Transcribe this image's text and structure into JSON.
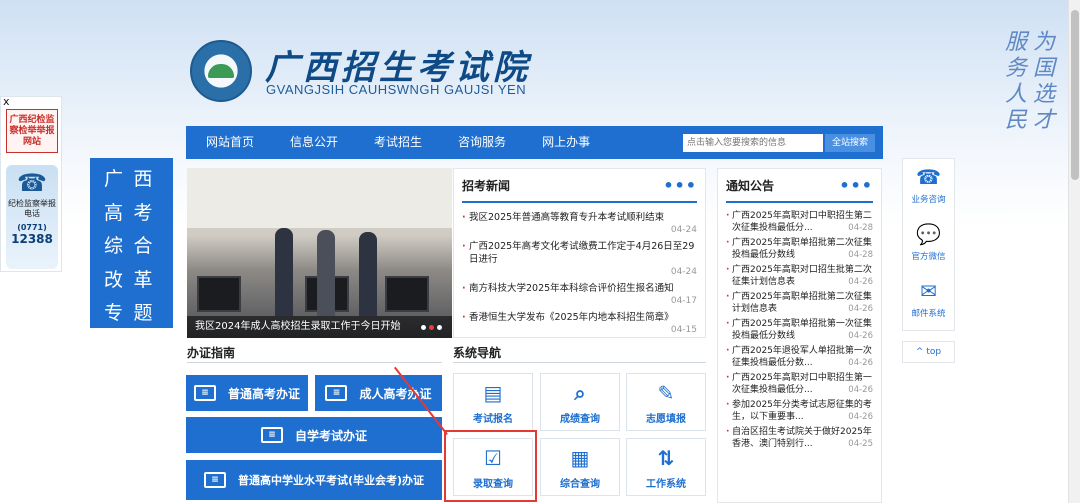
{
  "header": {
    "title": "广西招生考试院",
    "subtitle": "GVANGJSIH CAUHSWNGH GAUJSI YEN",
    "slogan": [
      "为",
      "服",
      "国",
      "务",
      "选",
      "人",
      "才",
      "民"
    ]
  },
  "left_float": {
    "close": "x",
    "jw_label": "广西纪检监察检举举报网站",
    "phone_label": "纪检监察举报电话",
    "phone_code": "(0771)",
    "phone_number": "12388"
  },
  "nav": {
    "items": [
      "网站首页",
      "信息公开",
      "考试招生",
      "咨询服务",
      "网上办事"
    ],
    "search_placeholder": "点击输入您要搜索的信息",
    "search_button": "全站搜索"
  },
  "special": [
    "广",
    "西",
    "高",
    "考",
    "综",
    "合",
    "改",
    "革",
    "专",
    "题"
  ],
  "photo": {
    "caption": "我区2024年成人高校招生录取工作于今日开始"
  },
  "news": {
    "title": "招考新闻",
    "more": "•••",
    "items": [
      {
        "text": "我区2025年普通高等教育专升本考试顺利结束",
        "date": "04-24"
      },
      {
        "text": "广西2025年高考文化考试缴费工作定于4月26日至29日进行",
        "date": "04-24"
      },
      {
        "text": "南方科技大学2025年本科综合评价招生报名通知",
        "date": "04-17"
      },
      {
        "text": "香港恒生大学发布《2025年内地本科招生简章》",
        "date": "04-15"
      }
    ]
  },
  "notice": {
    "title": "通知公告",
    "more": "•••",
    "items": [
      {
        "text": "广西2025年高职对口中职招生第二次征集投档最低分...",
        "date": "04-28"
      },
      {
        "text": "广西2025年高职单招批第二次征集投档最低分数线",
        "date": "04-28"
      },
      {
        "text": "广西2025年高职对口招生批第二次征集计划信息表",
        "date": "04-26"
      },
      {
        "text": "广西2025年高职单招批第二次征集计划信息表",
        "date": "04-26"
      },
      {
        "text": "广西2025年高职单招批第一次征集投档最低分数线",
        "date": "04-26"
      },
      {
        "text": "广西2025年退役军人单招批第一次征集投档最低分数...",
        "date": "04-26"
      },
      {
        "text": "广西2025年高职对口中职招生第一次征集投档最低分...",
        "date": "04-26"
      },
      {
        "text": "参加2025年分类考试志愿征集的考生，以下重要事...",
        "date": "04-26"
      },
      {
        "text": "自治区招生考试院关于做好2025年香港、澳门特别行...",
        "date": "04-25"
      }
    ]
  },
  "tools": [
    {
      "icon": "phone-icon",
      "glyph": "☎",
      "label": "业务咨询"
    },
    {
      "icon": "wechat-icon",
      "glyph": "💬",
      "label": "官方微信"
    },
    {
      "icon": "mail-icon",
      "glyph": "✉",
      "label": "邮件系统"
    }
  ],
  "top_button": "^ top",
  "guide": {
    "title": "办证指南",
    "buttons": [
      "普通高考办证",
      "成人高考办证",
      "自学考试办证",
      "普通高中学业水平考试(毕业会考)办证"
    ]
  },
  "system": {
    "title": "系统导航",
    "tiles": [
      {
        "icon": "register-icon",
        "glyph": "▤",
        "label": "考试报名"
      },
      {
        "icon": "search-icon",
        "glyph": "⌕",
        "label": "成绩查询"
      },
      {
        "icon": "edit-icon",
        "glyph": "✎",
        "label": "志愿填报"
      },
      {
        "icon": "admission-icon",
        "glyph": "☑",
        "label": "录取查询"
      },
      {
        "icon": "grid-search-icon",
        "glyph": "▦",
        "label": "综合查询"
      },
      {
        "icon": "work-icon",
        "glyph": "⇅",
        "label": "工作系统"
      }
    ]
  },
  "colors": {
    "primary": "#1e6fcf",
    "highlight": "#e53a33"
  }
}
